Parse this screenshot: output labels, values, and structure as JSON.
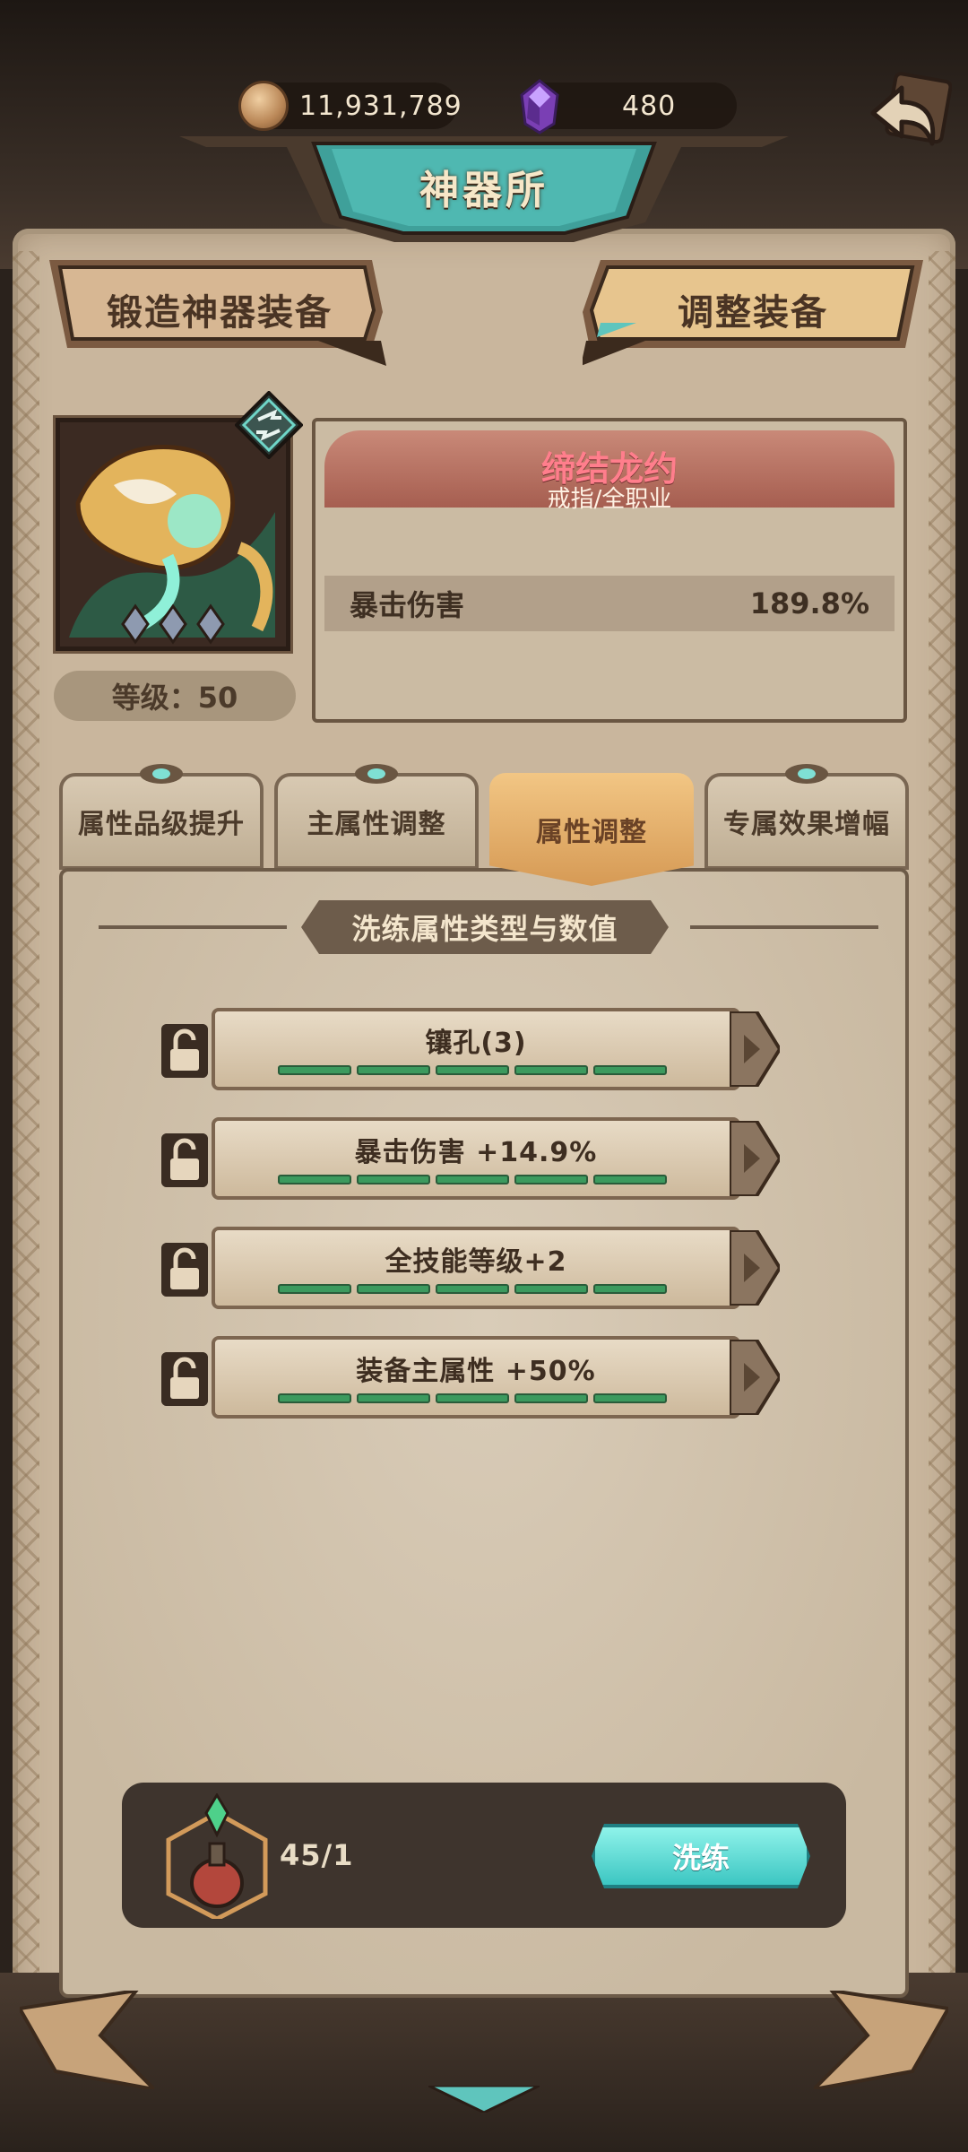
{
  "currency": {
    "coins": "11,931,789",
    "gems": "480"
  },
  "header": {
    "title": "神器所"
  },
  "top_buttons": {
    "forge": "锻造神器装备",
    "adjust": "调整装备"
  },
  "item": {
    "level_label": "等级：50",
    "name": "缔结龙约",
    "subtitle": "戒指/全职业",
    "stat_name": "暴击伤害",
    "stat_value": "189.8%"
  },
  "tabs": [
    {
      "label": "属性品级提升",
      "active": false
    },
    {
      "label": "主属性调整",
      "active": false
    },
    {
      "label": "属性调整",
      "active": true
    },
    {
      "label": "专属效果增幅",
      "active": false
    }
  ],
  "section_title": "洗练属性类型与数值",
  "properties": [
    {
      "label": "镶孔(3)",
      "level": 5
    },
    {
      "label": "暴击伤害 +14.9%",
      "level": 5
    },
    {
      "label": "全技能等级+2",
      "level": 5
    },
    {
      "label": "装备主属性 +50%",
      "level": 5
    }
  ],
  "action": {
    "material_count": "45/1",
    "refine_label": "洗练"
  },
  "colors": {
    "accent_teal": "#3cc6c2",
    "tab_active": "#d69a55",
    "item_name": "#ff7e8c",
    "bar_green": "#3c9a5e"
  },
  "icons": [
    "coin-icon",
    "gem-icon",
    "back-arrow-icon",
    "swap-icon",
    "lock-icon",
    "potion-icon"
  ]
}
